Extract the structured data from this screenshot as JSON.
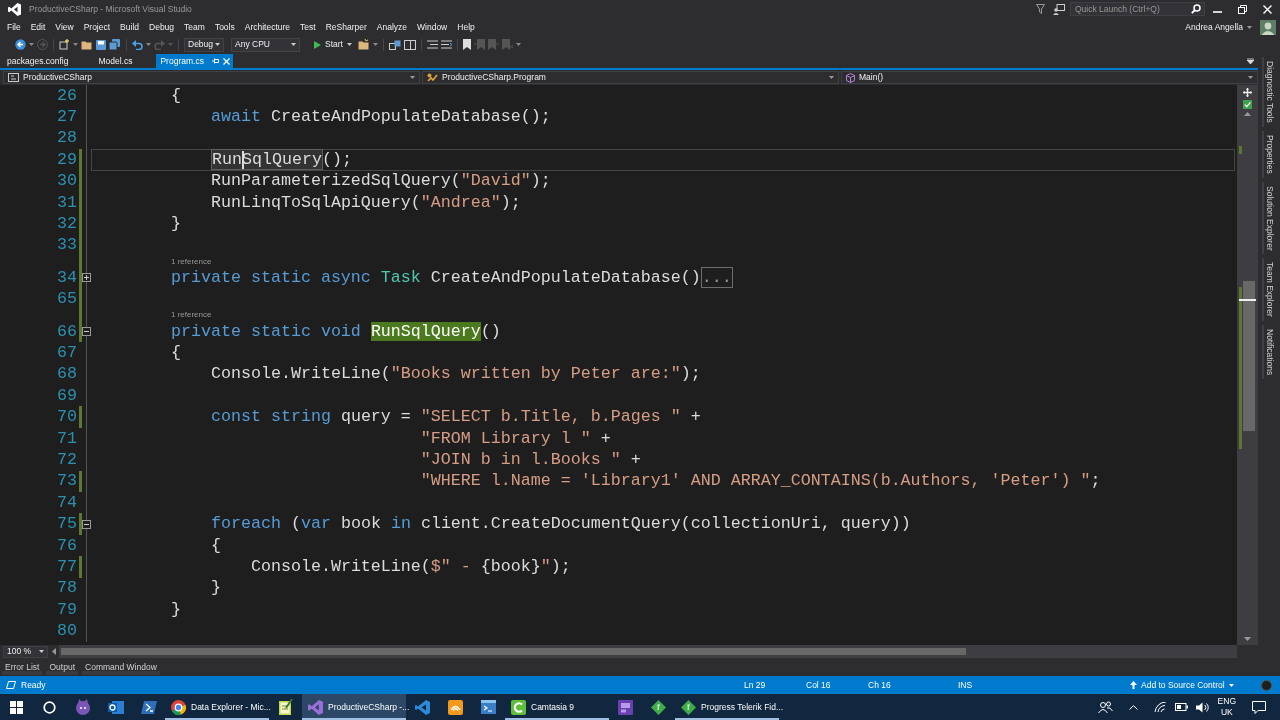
{
  "window": {
    "title": "ProductiveCSharp - Microsoft Visual Studio",
    "quick_launch": {
      "placeholder": "Quick Launch (Ctrl+Q)"
    }
  },
  "menu": {
    "items": [
      "File",
      "Edit",
      "View",
      "Project",
      "Build",
      "Debug",
      "Team",
      "Tools",
      "Architecture",
      "Test",
      "ReSharper",
      "Analyze",
      "Window",
      "Help"
    ],
    "user": "Andrea Angella"
  },
  "toolbar": {
    "configuration": "Debug",
    "platform": "Any CPU",
    "start": "Start"
  },
  "document_tabs": [
    {
      "label": "packages.config",
      "selected": false
    },
    {
      "label": "Model.cs",
      "selected": false
    },
    {
      "label": "Program.cs",
      "selected": true
    }
  ],
  "navigation_bar": {
    "project": "ProductiveCSharp",
    "type": "ProductiveCSharp.Program",
    "member": "Main()"
  },
  "editor": {
    "lines": [
      {
        "kind": "code",
        "number": "26",
        "changed": false,
        "current": false,
        "tokens": [
          {
            "kind": "plain",
            "text": "        {"
          }
        ]
      },
      {
        "kind": "code",
        "number": "27",
        "changed": false,
        "current": false,
        "tokens": [
          {
            "kind": "keyword",
            "text": "            await"
          },
          {
            "kind": "plain",
            "text": " CreateAndPopulateDatabase();"
          }
        ]
      },
      {
        "kind": "code",
        "number": "28",
        "changed": false,
        "current": false
      },
      {
        "kind": "code",
        "number": "29",
        "changed": true,
        "current": true,
        "tokens": [
          {
            "kind": "reference",
            "text": "            Run"
          },
          {
            "kind": "caret"
          },
          {
            "kind": "reference",
            "text": "SqlQuery"
          },
          {
            "kind": "plain",
            "text": "();"
          }
        ]
      },
      {
        "kind": "code",
        "number": "30",
        "changed": true,
        "current": false,
        "tokens": [
          {
            "kind": "plain",
            "text": "            RunParameterizedSqlQuery("
          },
          {
            "kind": "string",
            "text": "\"David\""
          },
          {
            "kind": "plain",
            "text": ");"
          }
        ]
      },
      {
        "kind": "code",
        "number": "31",
        "changed": true,
        "current": false,
        "tokens": [
          {
            "kind": "plain",
            "text": "            RunLinqToSqlApiQuery("
          },
          {
            "kind": "string",
            "text": "\"Andrea\""
          },
          {
            "kind": "plain",
            "text": ");"
          }
        ]
      },
      {
        "kind": "code",
        "number": "32",
        "changed": true,
        "current": false,
        "tokens": [
          {
            "kind": "plain",
            "text": "        }"
          }
        ]
      },
      {
        "kind": "code",
        "number": "33",
        "changed": true,
        "current": false
      },
      {
        "kind": "codelens",
        "text": "1 reference"
      },
      {
        "kind": "code",
        "number": "34",
        "changed": true,
        "current": false,
        "expanded": false,
        "tokens": [
          {
            "kind": "keyword",
            "text": "        private static async "
          },
          {
            "kind": "type",
            "text": "Task"
          },
          {
            "kind": "plain",
            "text": " CreateAndPopulateDatabase()"
          },
          {
            "kind": "collapsed",
            "text": "..."
          }
        ]
      },
      {
        "kind": "code",
        "number": "65",
        "changed": true,
        "current": false
      },
      {
        "kind": "codelens",
        "text": "1 reference"
      },
      {
        "kind": "code",
        "number": "66",
        "changed": true,
        "current": false,
        "expanded": true,
        "tokens": [
          {
            "kind": "keyword",
            "text": "        private static void "
          },
          {
            "kind": "definition",
            "text": "RunSqlQuery"
          },
          {
            "kind": "plain",
            "text": "()"
          }
        ]
      },
      {
        "kind": "code",
        "number": "67",
        "changed": false,
        "current": false,
        "tokens": [
          {
            "kind": "plain",
            "text": "        {"
          }
        ]
      },
      {
        "kind": "code",
        "number": "68",
        "changed": false,
        "current": false,
        "tokens": [
          {
            "kind": "plain",
            "text": "            Console.WriteLine("
          },
          {
            "kind": "string",
            "text": "\"Books written by Peter are:\""
          },
          {
            "kind": "plain",
            "text": ");"
          }
        ]
      },
      {
        "kind": "code",
        "number": "69",
        "changed": false,
        "current": false
      },
      {
        "kind": "code",
        "number": "70",
        "changed": true,
        "current": false,
        "tokens": [
          {
            "kind": "keyword",
            "text": "            const string"
          },
          {
            "kind": "plain",
            "text": " query = "
          },
          {
            "kind": "string",
            "text": "\"SELECT b.Title, b.Pages \""
          },
          {
            "kind": "plain",
            "text": " +"
          }
        ]
      },
      {
        "kind": "code",
        "number": "71",
        "changed": false,
        "current": false,
        "tokens": [
          {
            "kind": "string",
            "text": "                                 \"FROM Library l \""
          },
          {
            "kind": "plain",
            "text": " +"
          }
        ]
      },
      {
        "kind": "code",
        "number": "72",
        "changed": false,
        "current": false,
        "tokens": [
          {
            "kind": "string",
            "text": "                                 \"JOIN b in l.Books \""
          },
          {
            "kind": "plain",
            "text": " +"
          }
        ]
      },
      {
        "kind": "code",
        "number": "73",
        "changed": true,
        "current": false,
        "tokens": [
          {
            "kind": "string",
            "text": "                                 \"WHERE l.Name = 'Library1' AND ARRAY_CONTAINS(b.Authors, 'Peter') \""
          },
          {
            "kind": "plain",
            "text": ";"
          }
        ]
      },
      {
        "kind": "code",
        "number": "74",
        "changed": false,
        "current": false
      },
      {
        "kind": "code",
        "number": "75",
        "changed": true,
        "current": false,
        "expanded": true,
        "tokens": [
          {
            "kind": "keyword",
            "text": "            foreach"
          },
          {
            "kind": "plain",
            "text": " ("
          },
          {
            "kind": "keyword",
            "text": "var"
          },
          {
            "kind": "plain",
            "text": " book "
          },
          {
            "kind": "keyword",
            "text": "in"
          },
          {
            "kind": "plain",
            "text": " client.CreateDocumentQuery(collectionUri, query))"
          }
        ]
      },
      {
        "kind": "code",
        "number": "76",
        "changed": false,
        "current": false,
        "tokens": [
          {
            "kind": "plain",
            "text": "            {"
          }
        ]
      },
      {
        "kind": "code",
        "number": "77",
        "changed": true,
        "current": false,
        "tokens": [
          {
            "kind": "plain",
            "text": "                Console.WriteLine("
          },
          {
            "kind": "string",
            "text": "$\" - "
          },
          {
            "kind": "plain",
            "text": "{book}"
          },
          {
            "kind": "string",
            "text": "\""
          },
          {
            "kind": "plain",
            "text": ");"
          }
        ]
      },
      {
        "kind": "code",
        "number": "78",
        "changed": false,
        "current": false,
        "tokens": [
          {
            "kind": "plain",
            "text": "            }"
          }
        ]
      },
      {
        "kind": "code",
        "number": "79",
        "changed": false,
        "current": false,
        "tokens": [
          {
            "kind": "plain",
            "text": "        }"
          }
        ]
      },
      {
        "kind": "code",
        "number": "80",
        "changed": false,
        "current": false
      }
    ]
  },
  "zoom": "100 %",
  "tool_tabs": [
    "Error List",
    "Output",
    "Command Window"
  ],
  "side_tabs": [
    "Diagnostic Tools",
    "Properties",
    "Solution Explorer",
    "Team Explorer",
    "Notifications"
  ],
  "status_bar": {
    "state": "Ready",
    "line": "Ln 29",
    "column": "Col 16",
    "character": "Ch 16",
    "mode": "INS",
    "source_control": "Add to Source Control"
  },
  "taskbar": {
    "apps": [
      {
        "running": false,
        "selected": false
      },
      {
        "running": false,
        "selected": false
      },
      {
        "running": false,
        "selected": false
      },
      {
        "label": "Data Explorer - Mic...",
        "running": true,
        "selected": false
      },
      {
        "running": false,
        "selected": false
      },
      {
        "label": "ProductiveCSharp -...",
        "running": true,
        "selected": true
      },
      {
        "running": false,
        "selected": false
      },
      {
        "running": false,
        "selected": false
      },
      {
        "running": false,
        "selected": false
      },
      {
        "label": "Camtasia 9",
        "running": true,
        "selected": false
      },
      {
        "running": false,
        "selected": false
      },
      {
        "running": false,
        "selected": false
      },
      {
        "label": "Progress Telerik Fid...",
        "running": true,
        "selected": false
      }
    ],
    "language": "ENG",
    "region": "UK"
  }
}
